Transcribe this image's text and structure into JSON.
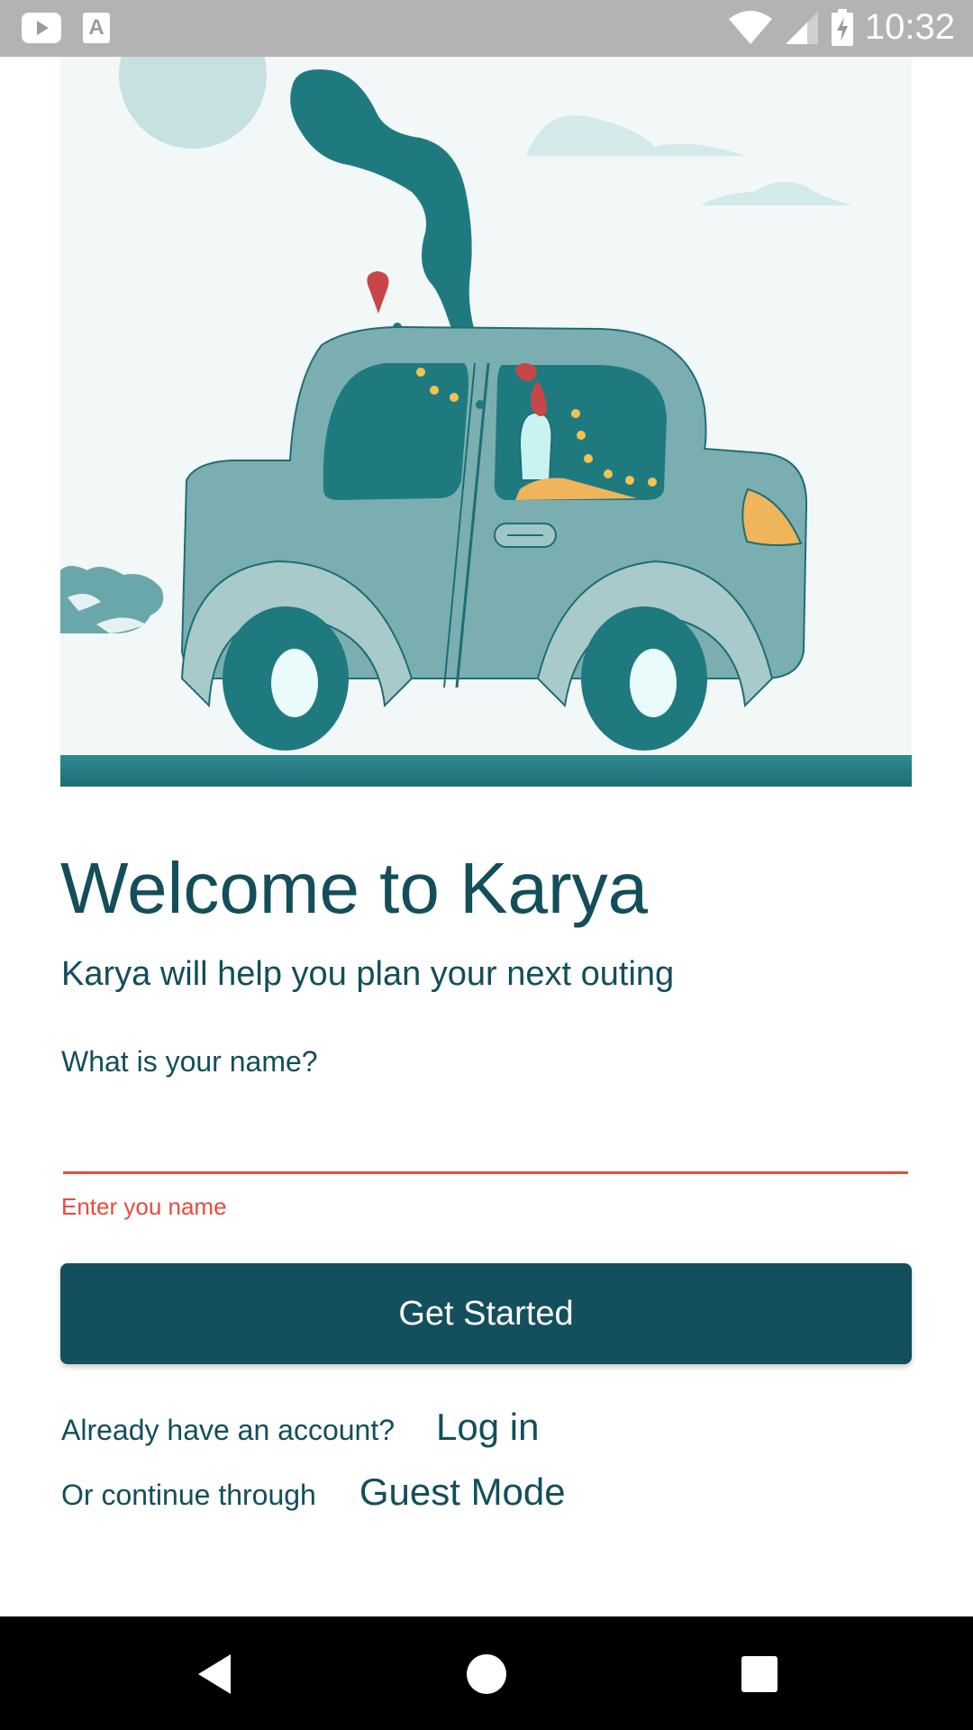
{
  "status_bar": {
    "time": "10:32",
    "left_icons": [
      "youtube-icon",
      "a-keyboard-icon"
    ],
    "right_icons": [
      "wifi-icon",
      "signal-icon",
      "battery-charging-icon"
    ]
  },
  "hero": {
    "illustration": "car-with-smoke-illustration",
    "colors": {
      "background": "#f2f7f8",
      "teal_dark": "#1f7a80",
      "teal_body": "#7aaeb0",
      "ground": "#2f8a8f",
      "accent_orange": "#f0b45a",
      "accent_red": "#c8464a"
    }
  },
  "welcome": {
    "title": "Welcome to Karya",
    "subtitle": "Karya will help you plan your next outing"
  },
  "name_form": {
    "label": "What is your name?",
    "value": "",
    "error": "Enter you name"
  },
  "actions": {
    "get_started": "Get Started",
    "login_prompt": "Already have an account?",
    "login_link": "Log in",
    "guest_prompt": "Or continue through",
    "guest_link": "Guest Mode"
  },
  "nav_bar": {
    "icons": [
      "back-icon",
      "home-icon",
      "recents-icon"
    ]
  },
  "theme": {
    "primary": "#134f5c",
    "error": "#e84b3c",
    "text": "#134e5a"
  }
}
